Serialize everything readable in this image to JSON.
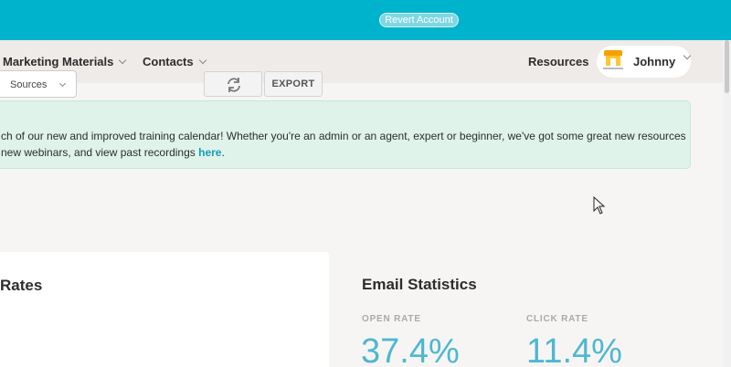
{
  "topbar": {
    "revert_label": "Revert Account"
  },
  "nav": {
    "marketing_label": "Marketing Materials",
    "contacts_label": "Contacts",
    "resources_label": "Resources",
    "user_name": "Johnny"
  },
  "banner": {
    "line1": "ch of our new and improved training calendar! Whether you're an admin or an agent, expert or beginner, we've got some great new resources",
    "line2_text": "new webinars, and view past recordings ",
    "link_text": "here",
    "line2_end": "."
  },
  "card": {
    "title": "Rates",
    "select_value": "Sources",
    "export_label": "EXPORT"
  },
  "stats": {
    "title": "Email Statistics",
    "open_label": "OPEN RATE",
    "open_value": "37.4%",
    "click_label": "CLICK RATE",
    "click_value": "11.4%"
  },
  "colors": {
    "topbar": "#00b3cc",
    "accent": "#4db8d1",
    "banner_bg": "#dff3ea"
  },
  "icons": [
    "chevron-down-icon",
    "store-avatar-icon",
    "refresh-icon",
    "mouse-cursor-icon"
  ]
}
